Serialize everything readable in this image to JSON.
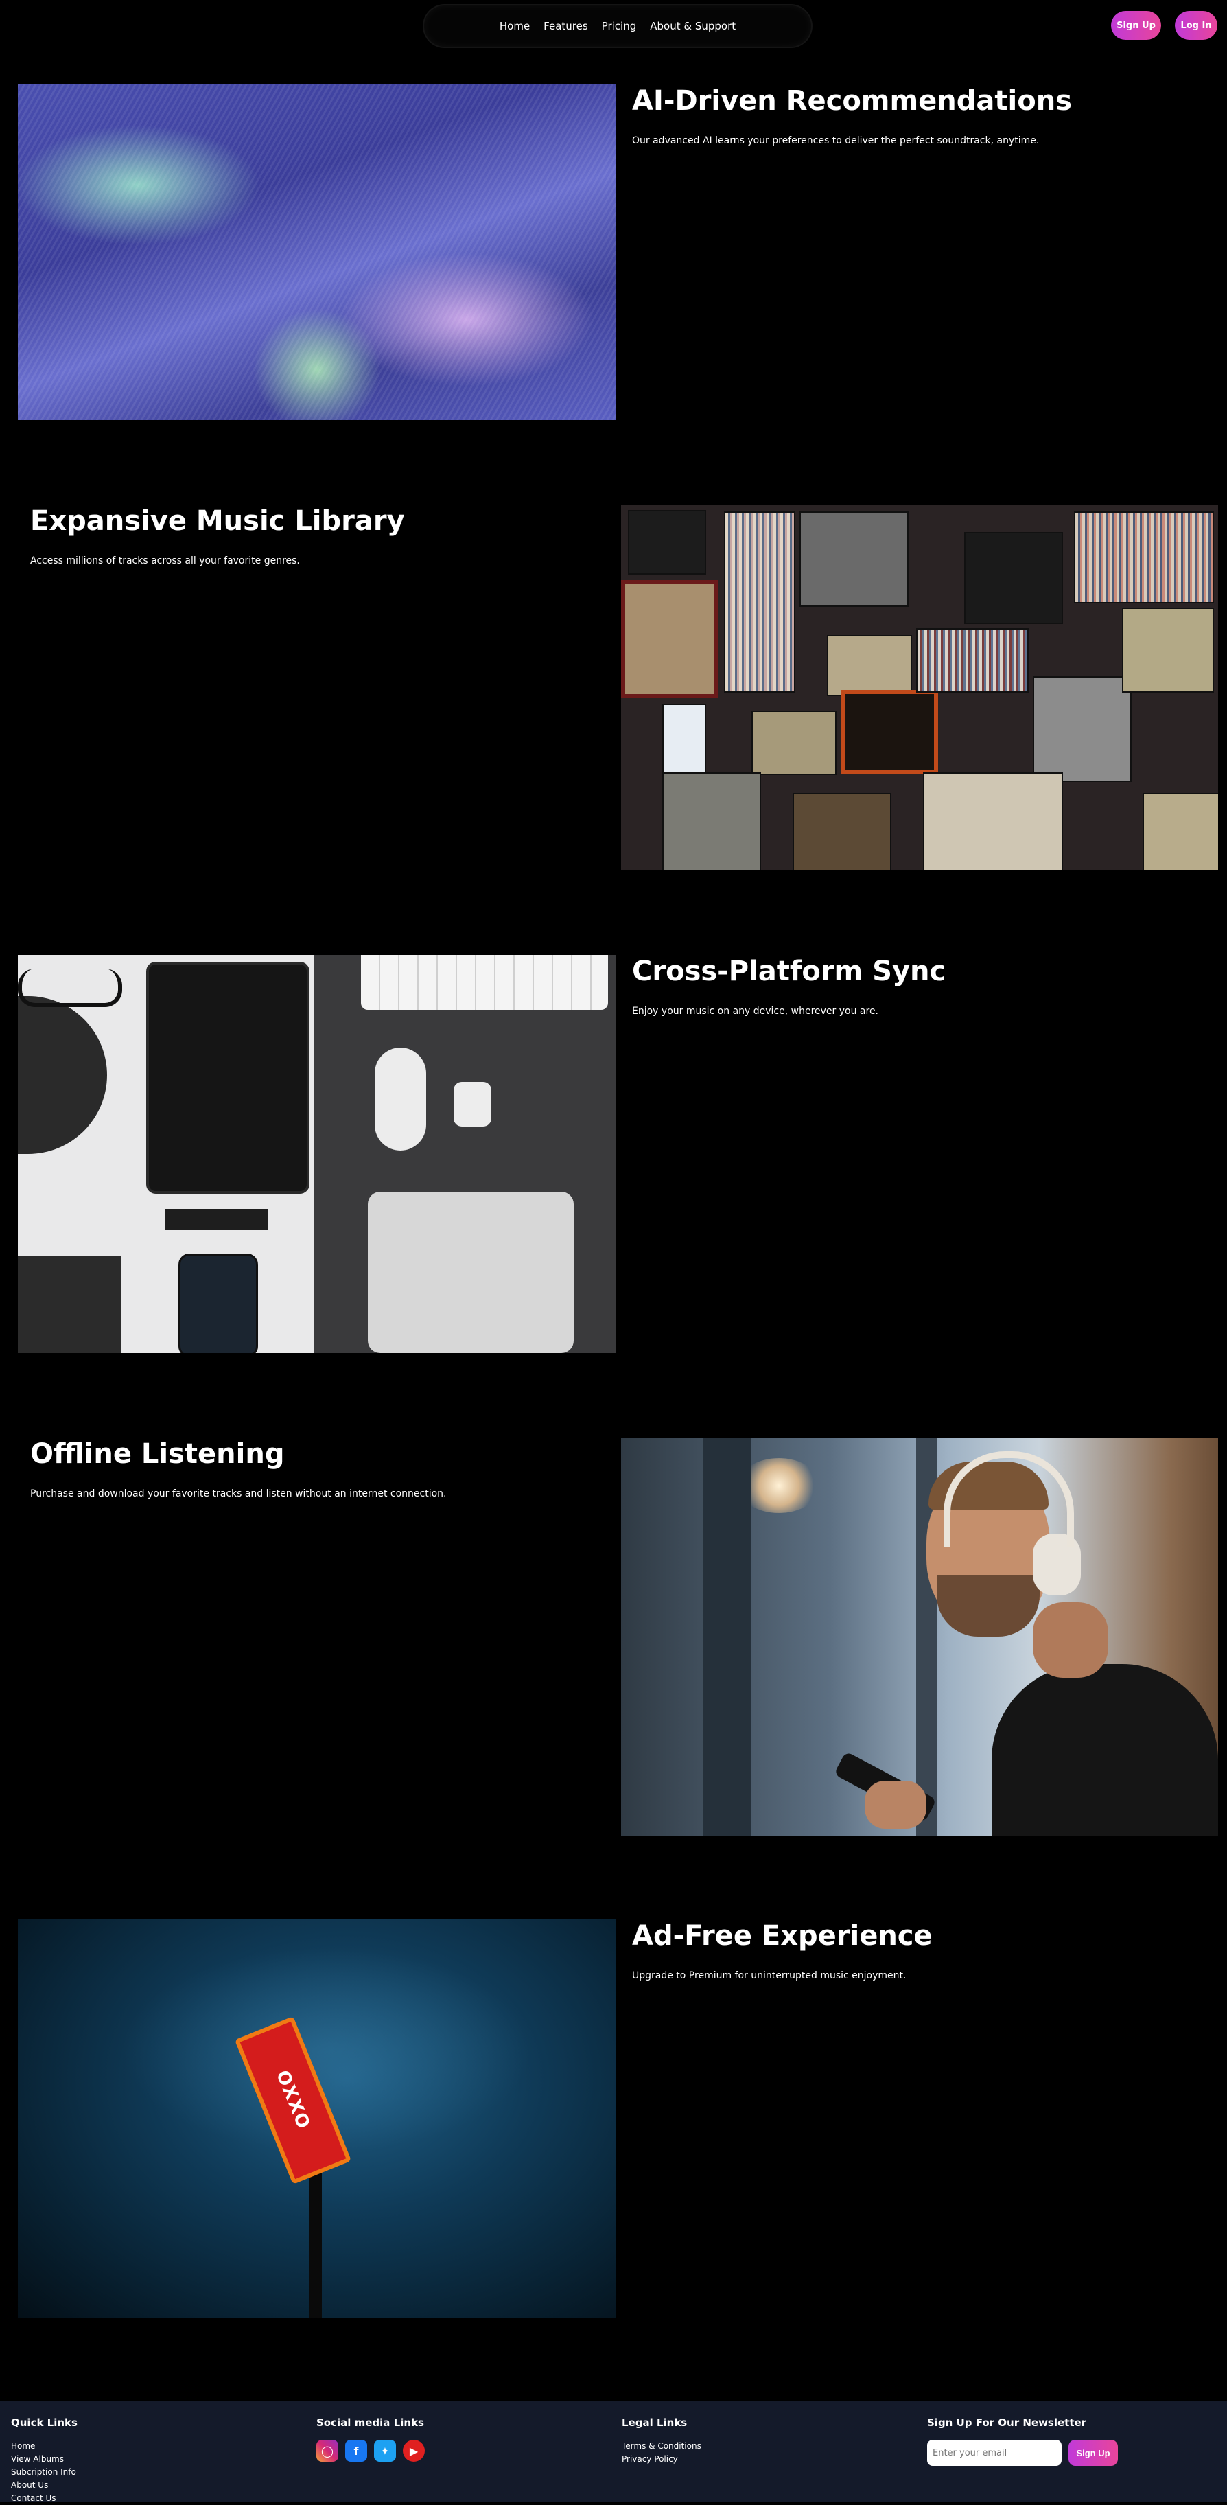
{
  "nav": {
    "items": [
      "Home",
      "Features",
      "Pricing",
      "About & Support"
    ]
  },
  "auth": {
    "signup": "Sign Up",
    "login": "Log In"
  },
  "features": [
    {
      "title": "AI-Driven Recommendations",
      "desc": "Our advanced AI learns your preferences to deliver the perfect soundtrack, anytime."
    },
    {
      "title": "Expansive Music Library",
      "desc": "Access millions of tracks across all your favorite genres."
    },
    {
      "title": "Cross-Platform Sync",
      "desc": "Enjoy your music on any device, wherever you are."
    },
    {
      "title": "Offline Listening",
      "desc": "Purchase and download your favorite tracks and listen without an internet connection."
    },
    {
      "title": "Ad-Free Experience",
      "desc": "Upgrade to Premium for uninterrupted music enjoyment."
    }
  ],
  "footer": {
    "quick": {
      "title": "Quick Links",
      "links": [
        "Home",
        "View Albums",
        "Subcription Info",
        "About Us",
        "Contact Us"
      ]
    },
    "social": {
      "title": "Social media Links"
    },
    "legal": {
      "title": "Legal Links",
      "links": [
        "Terms & Conditions",
        "Privacy Policy"
      ]
    },
    "newsletter": {
      "title": "Sign Up For Our Newsletter",
      "placeholder": "Enter your email",
      "button": "Sign Up"
    }
  },
  "images": {
    "sign_text": "OXXO"
  },
  "colors": {
    "accent_start": "#c13ad8",
    "accent_end": "#e8459a",
    "footer_bg": "#141a2a"
  }
}
